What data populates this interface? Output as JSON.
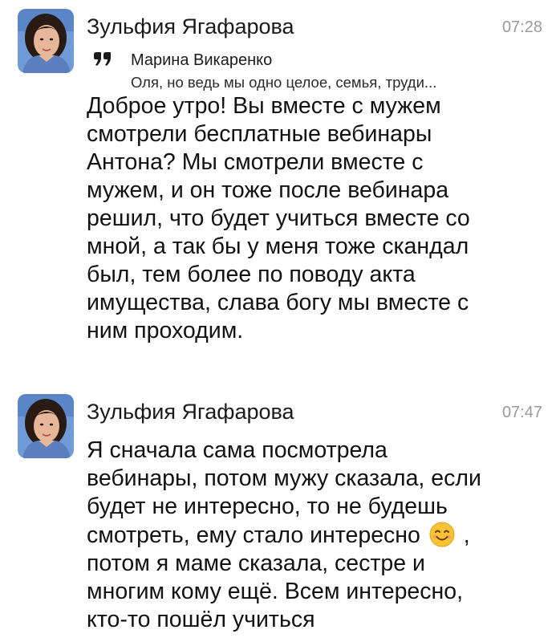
{
  "messages": [
    {
      "sender": "Зульфия Ягафарова",
      "time": "07:28",
      "avatar_icon": "user-photo-avatar",
      "quote": {
        "icon": "quote-icon",
        "author": "Марина Викаренко",
        "text": "Оля, но ведь мы одно целое, семья, труди..."
      },
      "text": "Доброе утро! Вы вместе с мужем\nсмотрели бесплатные вебинары\nАнтона? Мы смотрели вместе с\nмужем, и он тоже после вебинара\nрешил, что будет учиться вместе со\nмной, а так бы у меня тоже скандал\nбыл, тем более по поводу акта\nимущества, слава богу мы вместе с\nним проходим."
    },
    {
      "sender": "Зульфия Ягафарова",
      "time": "07:47",
      "avatar_icon": "user-photo-avatar",
      "text_before_emoji": "Я сначала сама посмотрела\nвебинары, потом мужу сказала, если\nбудет не интересно, то не будешь\nсмотреть, ему стало интересно ",
      "emoji": "smiling-face-emoji",
      "text_after_emoji": " ,\nпотом я маме сказала, сестре и\nмногим кому ещё. Всем интересно,\nкто-то пошёл учиться"
    }
  ],
  "colors": {
    "text": "#121212",
    "time": "#9a9a9a",
    "emoji_yellow": "#f7c234"
  }
}
